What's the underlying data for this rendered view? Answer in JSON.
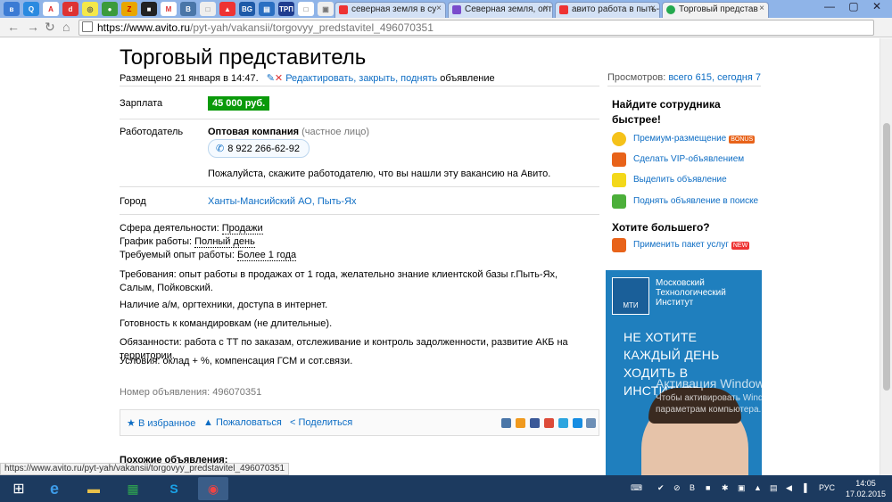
{
  "browser": {
    "tabs": [
      {
        "label": "северная земля в су"
      },
      {
        "label": "Северная земля, опт"
      },
      {
        "label": "авито работа в пыть-"
      },
      {
        "label": "Торговый представ"
      }
    ],
    "url_host": "https://www.avito.ru",
    "url_path": "/pyt-yah/vakansii/torgovyy_predstavitel_496070351"
  },
  "listing": {
    "title": "Торговый представитель",
    "placed": "Размещено 21 января в 14:47.",
    "edit_link": "Редактировать, закрыть, поднять",
    "edit_suffix": "объявление",
    "views_label": "Просмотров:",
    "views_value": "всего 615, сегодня 7",
    "salary_label": "Зарплата",
    "salary_value": "45 000 руб.",
    "employer_label": "Работодатель",
    "employer_name": "Оптовая компания",
    "employer_type": "(частное лицо)",
    "phone": "8 922 266-62-92",
    "tell_employer": "Пожалуйста, скажите работодателю, что вы нашли эту вакансию на Авито.",
    "city_label": "Город",
    "city_value": "Ханты-Мансийский АО, Пыть-Ях",
    "sphere_label": "Сфера деятельности:",
    "sphere_value": "Продажи",
    "schedule_label": "График работы:",
    "schedule_value": "Полный день",
    "experience_label": "Требуемый опыт работы:",
    "experience_value": "Более 1 года",
    "req1": "Требования: опыт работы в продажах от 1 года, желательно знание клиентской базы г.Пыть-Ях, Салым, Пойковский.",
    "req2": "Наличие а/м, оргтехники, доступа в интернет.",
    "req3": "Готовность к командировкам (не длительные).",
    "req4": "Обязанности: работа с ТТ по заказам, отслеживание и контроль задолженности, развитие АКБ на территории.",
    "req5": "Условия: оклад + %, компенсация ГСМ и сот.связи.",
    "ad_number": "Номер объявления: 496070351",
    "favorite": "В избранное",
    "complain": "Пожаловаться",
    "share": "Поделиться",
    "similar": "Похожие объявления:"
  },
  "sidebar": {
    "find_title": "Найдите сотрудника быстрее!",
    "items": [
      {
        "label": "Премиум-размещение",
        "badge": "BONUS"
      },
      {
        "label": "Сделать VIP-объявлением"
      },
      {
        "label": "Выделить объявление"
      },
      {
        "label": "Поднять объявление в поиске"
      }
    ],
    "more_title": "Хотите большего?",
    "package": {
      "label": "Применить пакет услуг",
      "badge": "NEW"
    }
  },
  "ad_banner": {
    "logo": "МТИ",
    "org": "Московский Технологический Институт",
    "slogan": "НЕ ХОТИТЕ КАЖДЫЙ ДЕНЬ ХОДИТЬ В ИНСТИТУТ?"
  },
  "overlay": {
    "activation_title": "Активация Windows",
    "activation_text": "Чтобы активировать Windows, перейдите к параметрам компьютера."
  },
  "status_url": "https://www.avito.ru/pyt-yah/vakansii/torgovyy_predstavitel_496070351",
  "taskbar": {
    "lang": "РУС",
    "time": "14:05",
    "date": "17.02.2015"
  },
  "colors": {
    "link": "#0d6dc4",
    "salary_bg": "#0a9a0a",
    "ad_bg": "#1f7fbe",
    "taskbar": "#1c3a5f"
  }
}
